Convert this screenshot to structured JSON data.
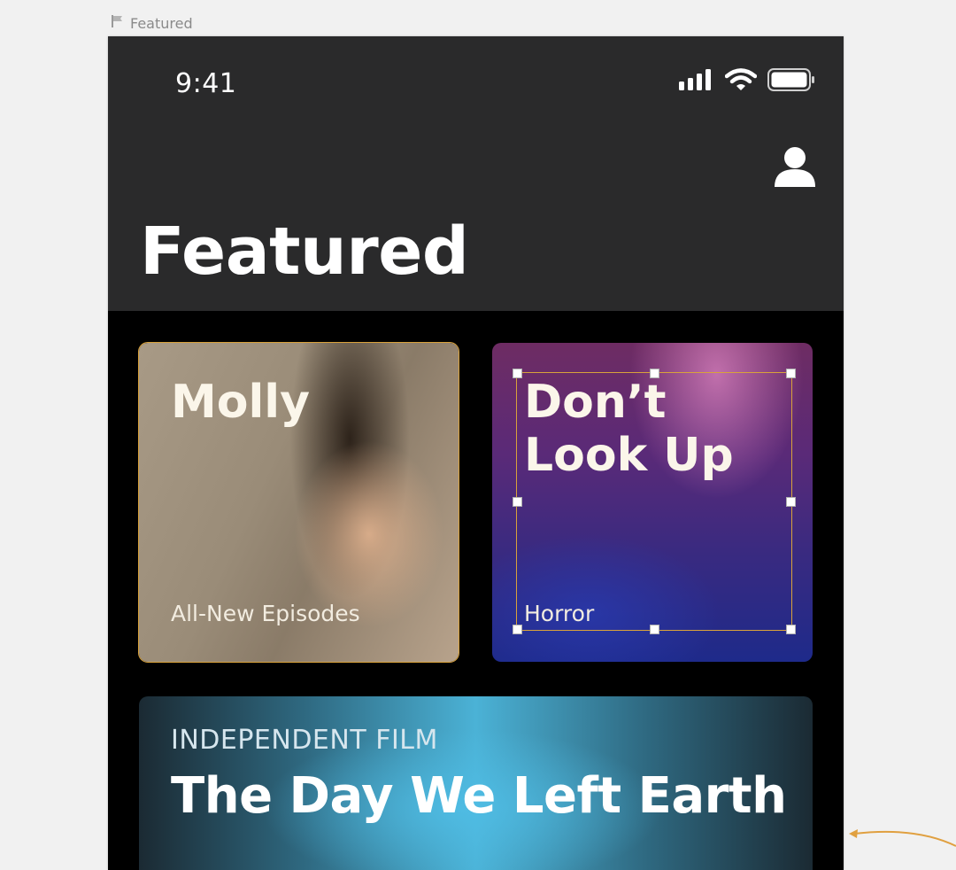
{
  "artboard": {
    "label": "Featured",
    "flag_icon": "flag-icon"
  },
  "status_bar": {
    "time": "9:41",
    "icons": [
      "signal-icon",
      "wifi-icon",
      "battery-icon"
    ]
  },
  "nav": {
    "title": "Featured",
    "profile_icon": "profile-icon"
  },
  "cards": [
    {
      "title": "Molly",
      "subtitle": "All-New Episodes"
    },
    {
      "title": "Don’t Look Up",
      "subtitle": "Horror"
    },
    {
      "kicker": "INDEPENDENT FILM",
      "title": "The Day We Left Earth"
    }
  ],
  "colors": {
    "accent": "#d9a23b",
    "nav_bg": "#2a2a2b",
    "content_bg": "#000000"
  }
}
